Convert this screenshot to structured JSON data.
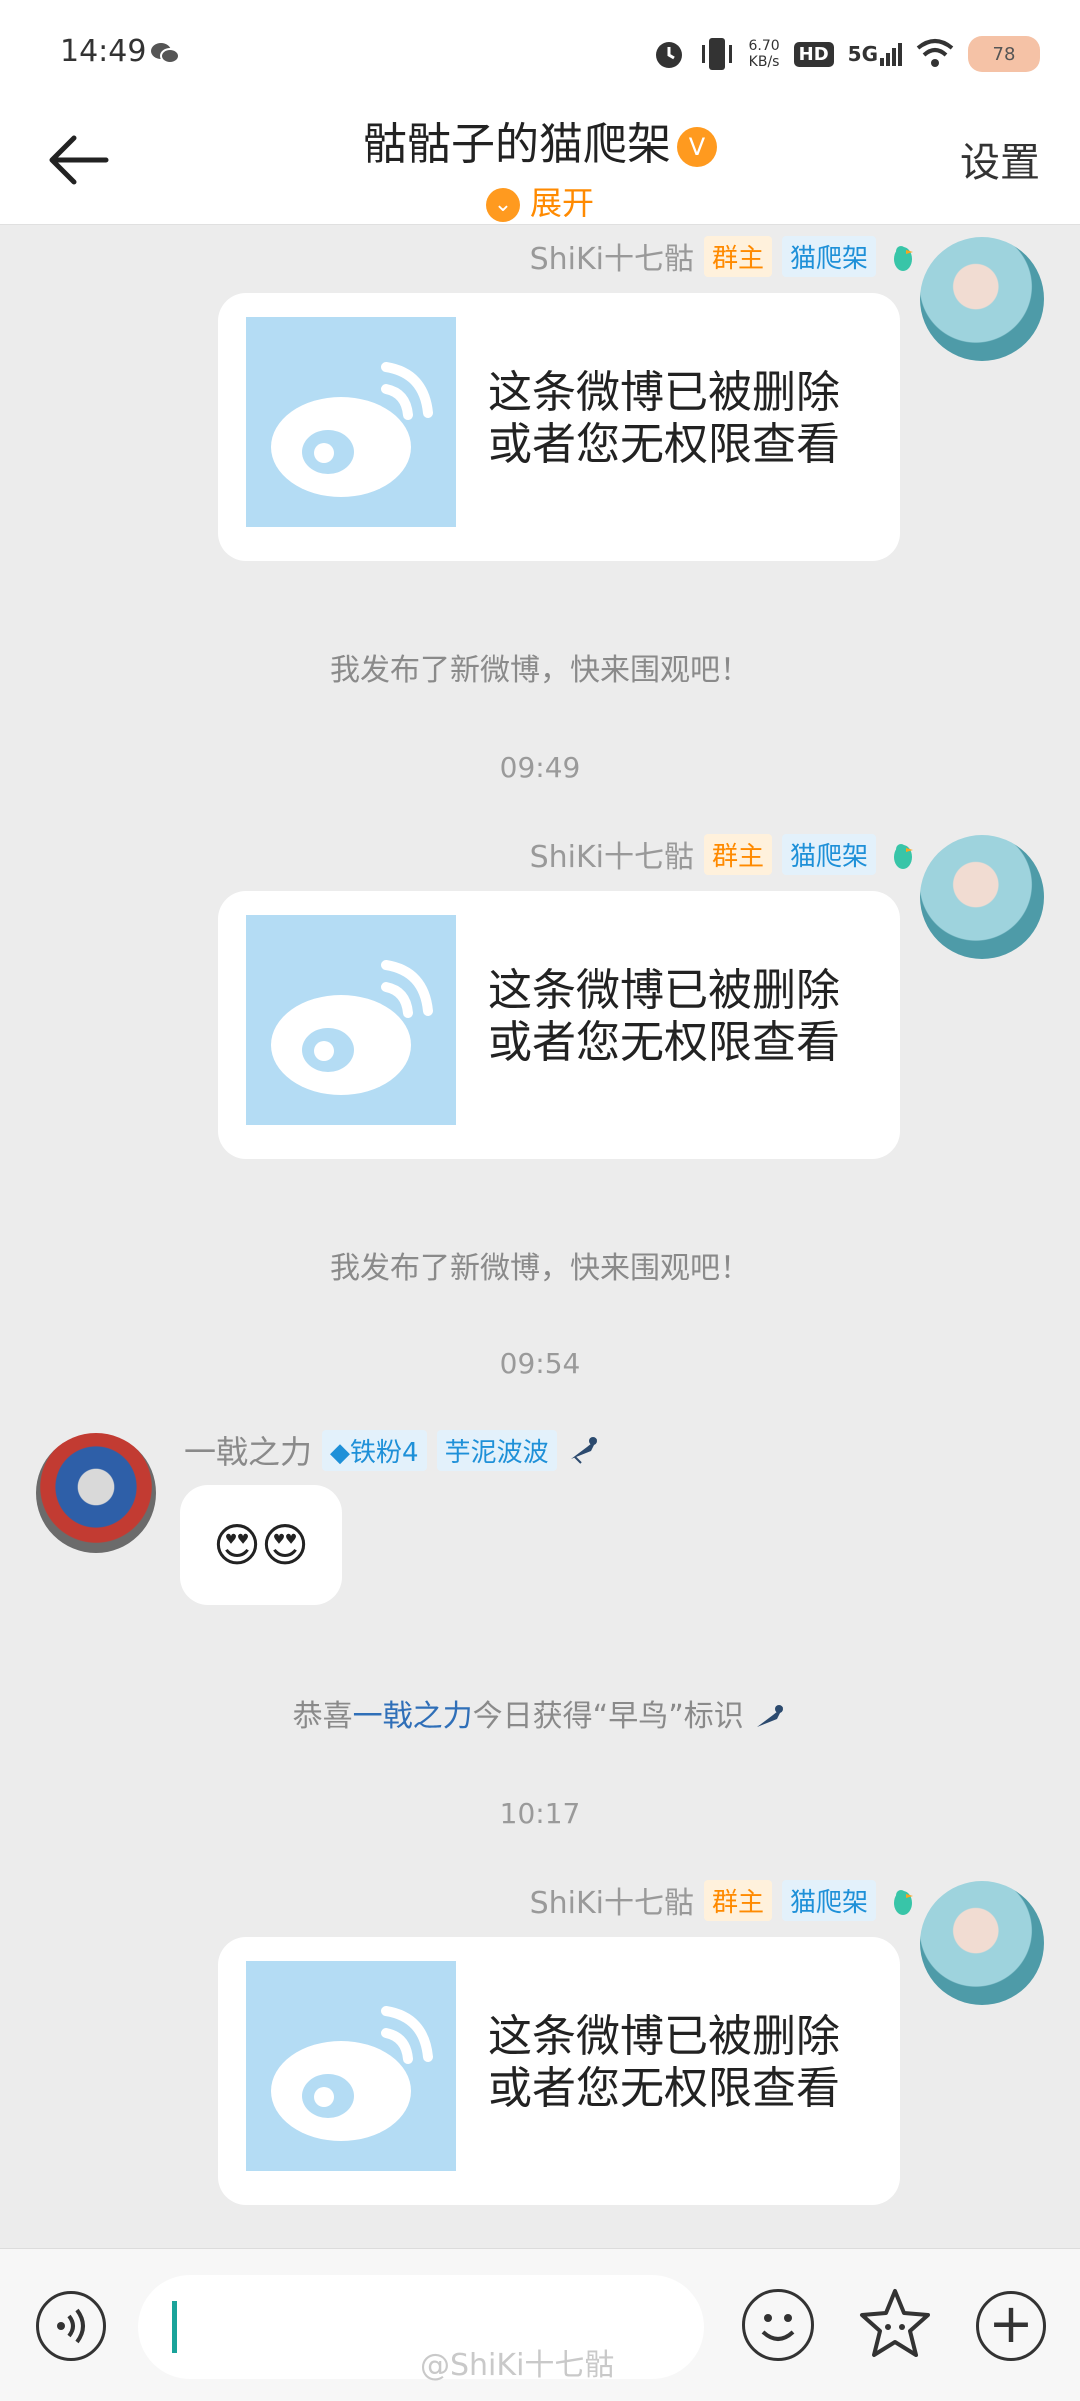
{
  "status_bar": {
    "time": "14:49",
    "speed_value": "6.70",
    "speed_unit": "KB/s",
    "hd": "HD",
    "network": "5G",
    "battery": "78"
  },
  "header": {
    "title": "骷骷子的猫爬架",
    "verified_mark": "V",
    "expand_label": "展开",
    "settings_label": "设置"
  },
  "messages": {
    "m1": {
      "sender": "ShiKi十七骷",
      "tag_owner": "群主",
      "tag_group": "猫爬架",
      "card_text_line1": "这条微博已被删除",
      "card_text_line2": "或者您无权限查看"
    },
    "sys1": "我发布了新微博，快来围观吧！",
    "time1": "09:49",
    "m2": {
      "sender": "ShiKi十七骷",
      "tag_owner": "群主",
      "tag_group": "猫爬架",
      "card_text_line1": "这条微博已被删除",
      "card_text_line2": "或者您无权限查看"
    },
    "sys2": "我发布了新微博，快来围观吧！",
    "time2": "09:54",
    "m3": {
      "sender": "一戟之力",
      "tag_fan": "铁粉4",
      "tag_group": "芋泥波波",
      "emoji": "😍😍"
    },
    "sys3_prefix": "恭喜",
    "sys3_name": "一戟之力",
    "sys3_suffix": "今日获得“早鸟”标识",
    "time3": "10:17",
    "m4": {
      "sender": "ShiKi十七骷",
      "tag_owner": "群主",
      "tag_group": "猫爬架",
      "card_text_line1": "这条微博已被删除",
      "card_text_line2": "或者您无权限查看"
    }
  },
  "watermark": "@ShiKi十七骷"
}
